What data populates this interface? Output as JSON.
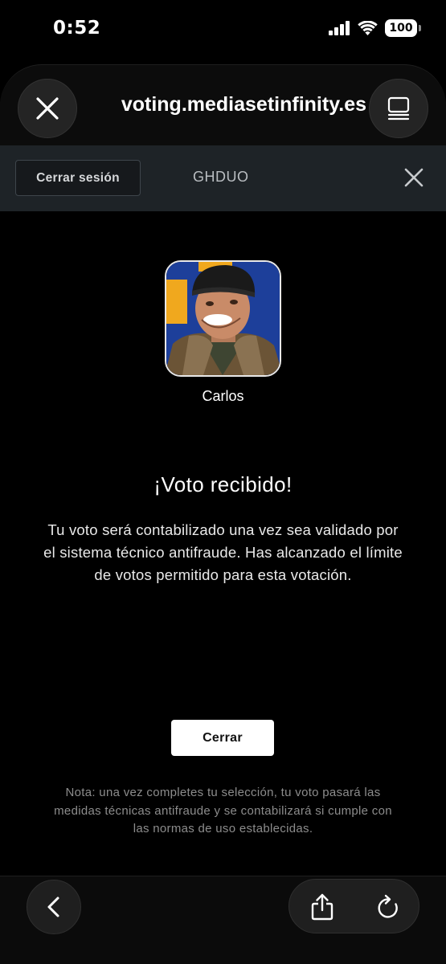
{
  "status_bar": {
    "time": "0:52",
    "battery": "100",
    "icons": [
      "cellular-signal-icon",
      "wifi-icon",
      "battery-icon"
    ]
  },
  "browser": {
    "url_display": "voting.mediasetinfinity.es",
    "close_icon": "close-icon",
    "tabs_icon": "tabs-icon",
    "back_icon": "chevron-left-icon",
    "share_icon": "share-icon",
    "reload_icon": "reload-icon"
  },
  "site_header": {
    "logout_label": "Cerrar sesión",
    "voter_code": "GHDUO",
    "close_icon": "close-icon"
  },
  "candidate": {
    "name": "Carlos"
  },
  "confirmation": {
    "title": "¡Voto recibido!",
    "message": "Tu voto será contabilizado una vez sea validado por el sistema técnico antifraude. Has alcanzado el límite de votos permitido para esta votación.",
    "close_label": "Cerrar",
    "note": "Nota: una vez completes tu selección, tu voto pasará las medidas técnicas antifraude y se contabilizará si cumple con las normas de uso establecidas."
  },
  "colors": {
    "background": "#000000",
    "header_bar": "#1e2327",
    "note_text": "#8c8c8c",
    "cta_background": "#ffffff"
  }
}
